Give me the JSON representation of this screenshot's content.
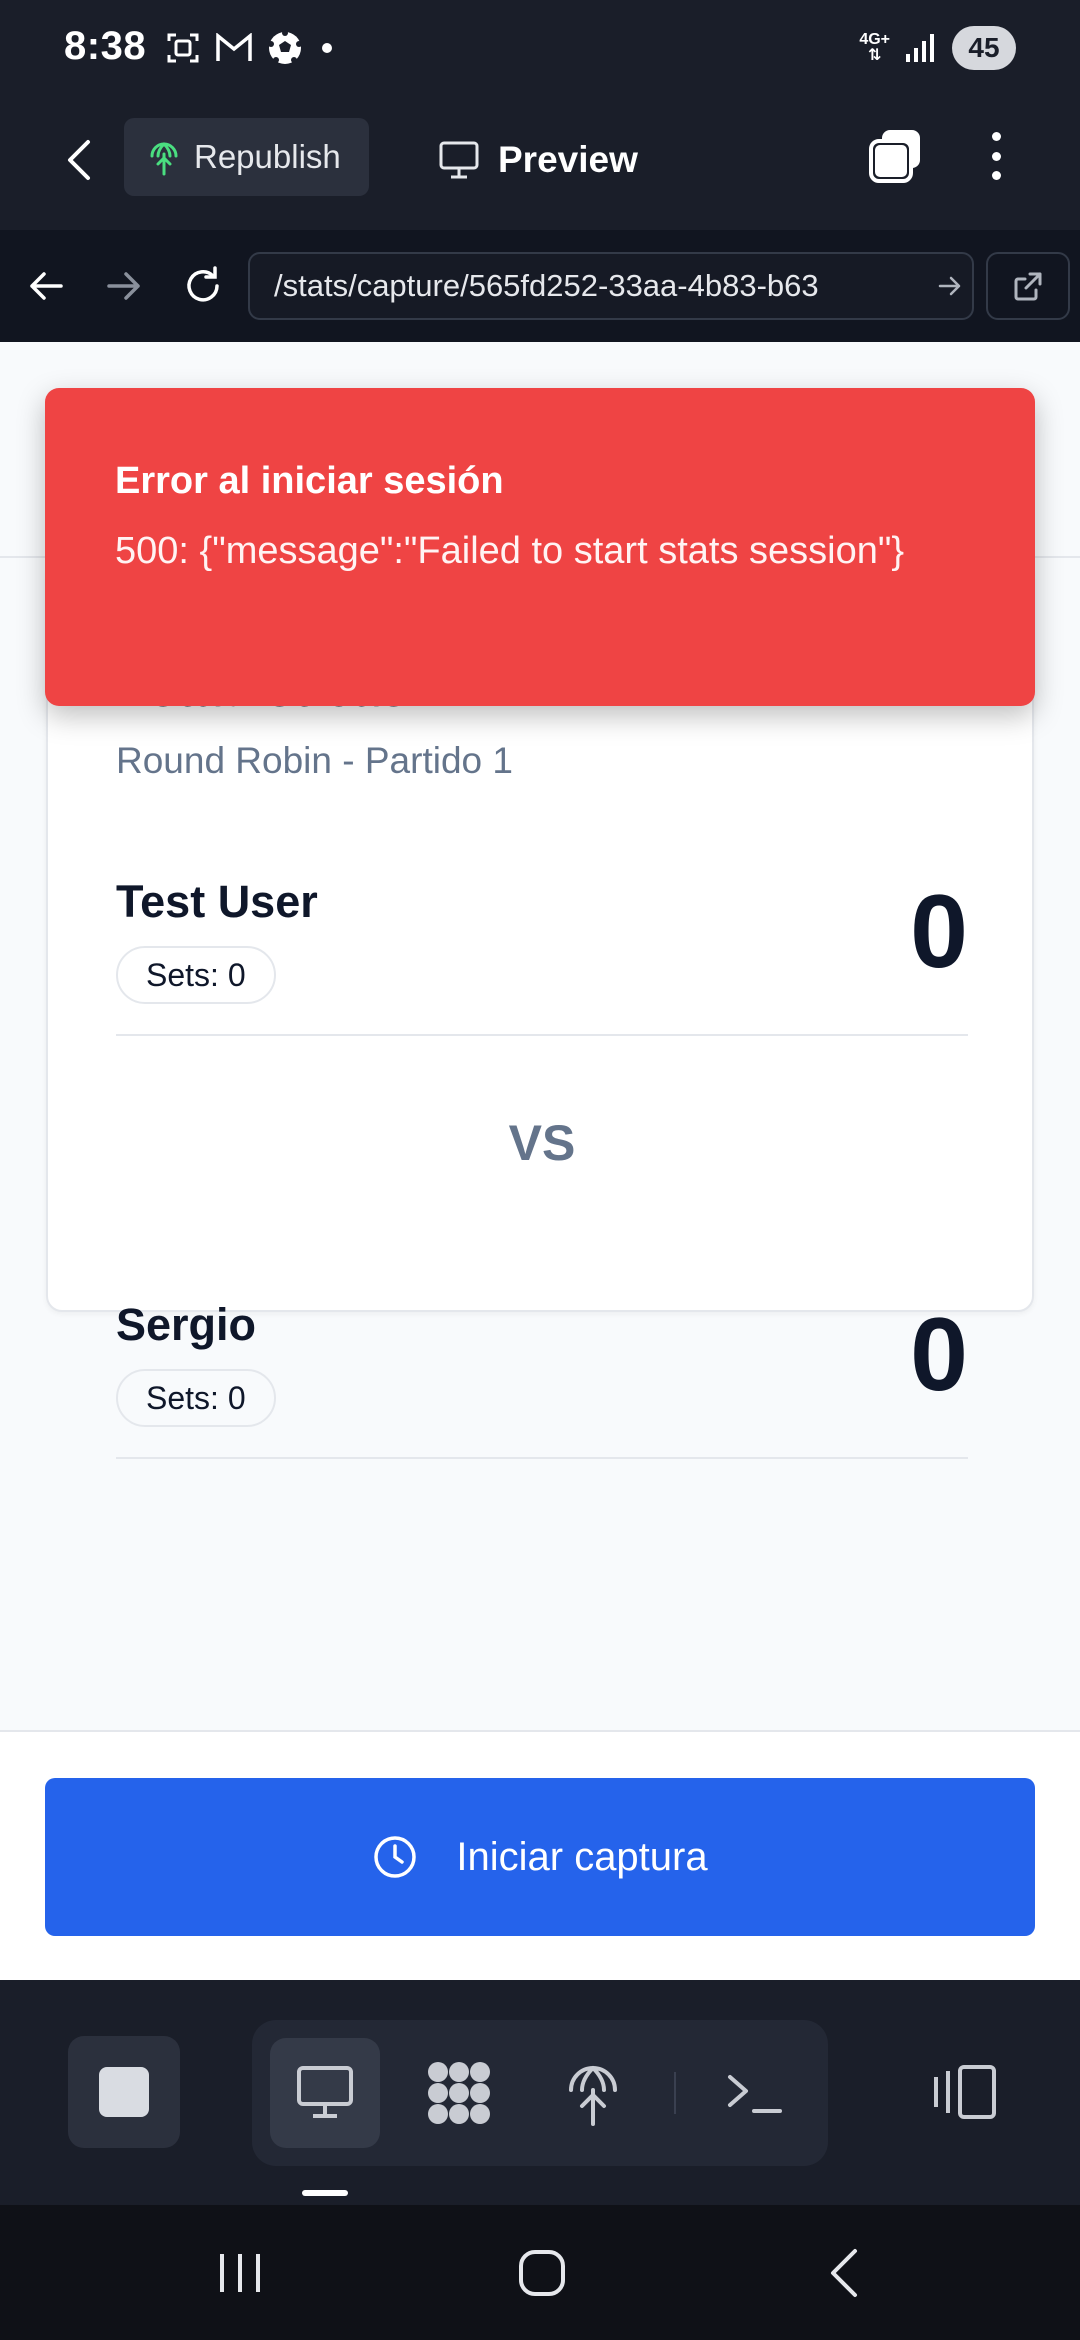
{
  "status_bar": {
    "time": "8:38",
    "network": "4G+",
    "battery": "45",
    "icons": [
      "screenshot-icon",
      "gmail-icon",
      "soccer-ball-icon",
      "dot-icon",
      "signal-icon"
    ]
  },
  "app_toolbar": {
    "republish_label": "Republish",
    "preview_label": "Preview"
  },
  "browser": {
    "url": "/stats/capture/565fd252-33aa-4b83-b63"
  },
  "toast": {
    "title": "Error al iniciar sesión",
    "message": "500: {\"message\":\"Failed to start stats session\"}"
  },
  "card": {
    "title": "Estadísticas",
    "subtitle": "Round Robin - Partido 1",
    "vs_label": "VS",
    "players": [
      {
        "name": "Test User",
        "sets": "Sets: 0",
        "score": "0"
      },
      {
        "name": "Sergio",
        "sets": "Sets: 0",
        "score": "0"
      }
    ]
  },
  "actions": {
    "start_capture": "Iniciar captura"
  },
  "colors": {
    "error": "#ef4444",
    "primary": "#2563eb",
    "toolbar_bg": "#1a1e29",
    "republish_icon": "#4ade80"
  }
}
